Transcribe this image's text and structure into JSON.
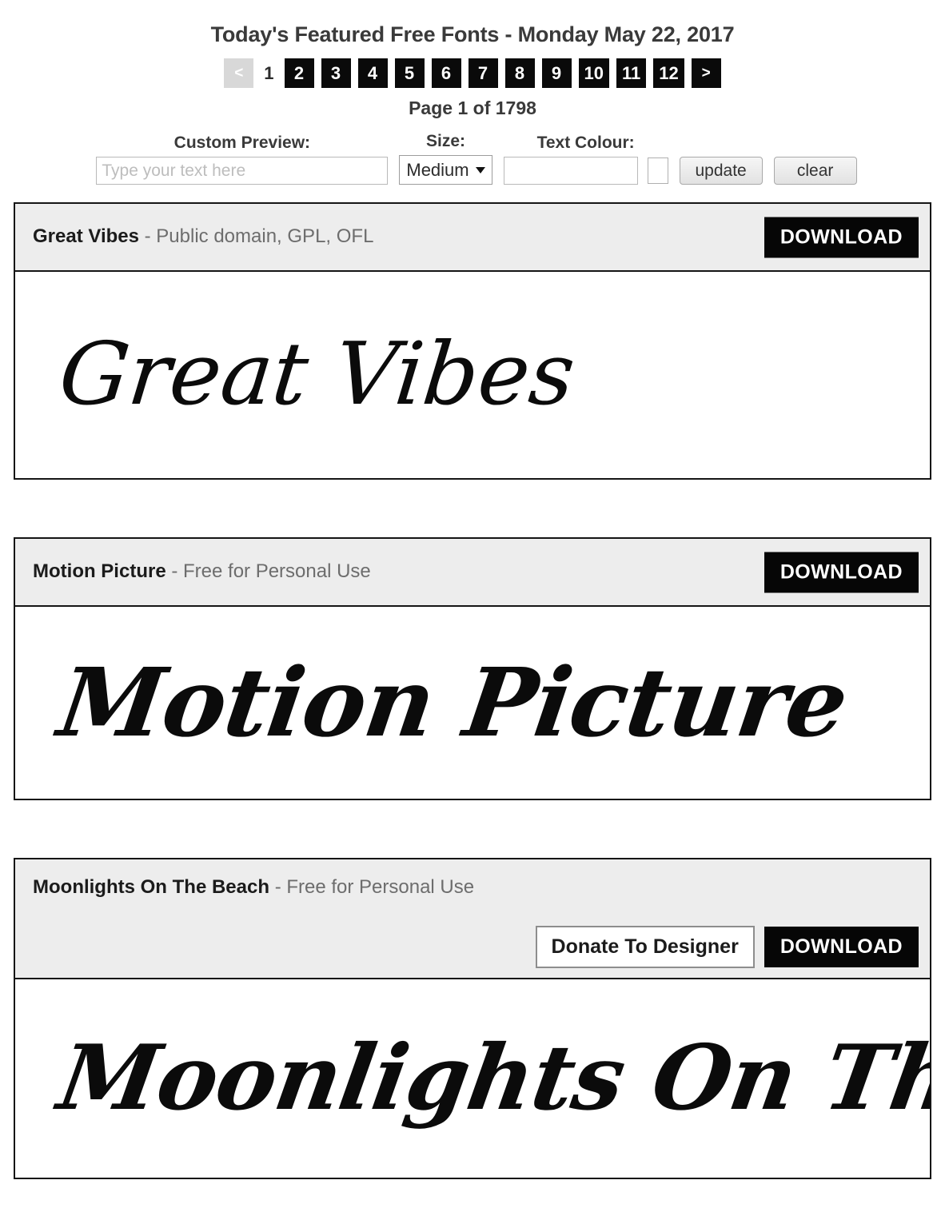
{
  "header": {
    "title": "Today's Featured Free Fonts - Monday May 22, 2017"
  },
  "pagination": {
    "prev_label": "<",
    "next_label": ">",
    "current_page_label": "1",
    "pages": [
      "2",
      "3",
      "4",
      "5",
      "6",
      "7",
      "8",
      "9",
      "10",
      "11",
      "12"
    ],
    "page_count_text": "Page 1 of 1798"
  },
  "controls": {
    "preview": {
      "label": "Custom Preview:",
      "value": "",
      "placeholder": "Type your text here"
    },
    "size": {
      "label": "Size:",
      "selected": "Medium"
    },
    "colour": {
      "label": "Text Colour:",
      "value": "",
      "placeholder": "",
      "swatch_color": "#ffffff"
    },
    "update_label": "update",
    "clear_label": "clear"
  },
  "fonts": [
    {
      "name": "Great Vibes",
      "license": "- Public domain, GPL, OFL",
      "download_label": "DOWNLOAD",
      "specimen": "Great Vibes",
      "has_donate": false
    },
    {
      "name": "Motion Picture",
      "license": "- Free for Personal Use",
      "download_label": "DOWNLOAD",
      "specimen": "Motion Picture",
      "has_donate": false
    },
    {
      "name": "Moonlights On The Beach",
      "license": "- Free for Personal Use",
      "download_label": "DOWNLOAD",
      "donate_label": "Donate To Designer",
      "specimen": "Moonlights On The Beach",
      "has_donate": true
    }
  ]
}
